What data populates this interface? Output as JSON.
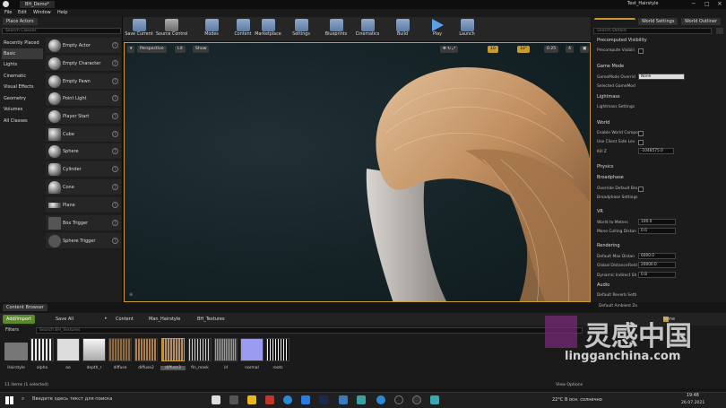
{
  "window": {
    "doc_title": "BH_Demo*",
    "project_title": "Test_Hairstyle"
  },
  "menu": [
    "File",
    "Edit",
    "Window",
    "Help"
  ],
  "place_actors": {
    "tab_label": "Place Actors",
    "search_placeholder": "Search Classes",
    "categories": [
      "Recently Placed",
      "Basic",
      "Lights",
      "Cinematic",
      "Visual Effects",
      "Geometry",
      "Volumes",
      "All Classes"
    ],
    "items": [
      "Empty Actor",
      "Empty Character",
      "Empty Pawn",
      "Point Light",
      "Player Start",
      "Cube",
      "Sphere",
      "Cylinder",
      "Cone",
      "Plane",
      "Box Trigger",
      "Sphere Trigger"
    ]
  },
  "toolbar": [
    "Save Current",
    "Source Control",
    "Modes",
    "Content",
    "Marketplace",
    "Settings",
    "Blueprints",
    "Cinematics",
    "Build",
    "Play",
    "Launch"
  ],
  "viewport": {
    "perspective": "Perspective",
    "lit": "Lit",
    "show": "Show",
    "snap_grid": "10",
    "snap_rot": "10°",
    "snap_scale": "0.25",
    "cam_speed": "4"
  },
  "details": {
    "tabs": [
      "World Settings",
      "World Outliner"
    ],
    "search_placeholder": "Search Details",
    "sections": [
      {
        "title": "Precomputed Visibility",
        "props": [
          {
            "label": "Precompute Visibili",
            "value": ""
          }
        ]
      },
      {
        "title": "Game Mode",
        "props": [
          {
            "label": "GameMode Overrid",
            "value": "None"
          },
          {
            "label": "Selected GameMod",
            "value": ""
          }
        ]
      },
      {
        "title": "Lightmass",
        "props": [
          {
            "label": "Lightmass Settings",
            "value": ""
          }
        ]
      },
      {
        "title": "World",
        "props": [
          {
            "label": "Enable World Compo",
            "value": ""
          },
          {
            "label": "Use Client Side Lev",
            "value": ""
          },
          {
            "label": "Kill Z",
            "value": "-1048575.0"
          }
        ]
      },
      {
        "title": "Physics",
        "props": []
      },
      {
        "title": "Broadphase",
        "props": [
          {
            "label": "Override Default Bro",
            "value": ""
          },
          {
            "label": "Broadphase Settings",
            "value": ""
          }
        ]
      },
      {
        "title": "VR",
        "props": [
          {
            "label": "World to Meters",
            "value": "100.0"
          },
          {
            "label": "Mono Culling Distan",
            "value": "0.0"
          }
        ]
      },
      {
        "title": "Rendering",
        "props": [
          {
            "label": "Default Max Distan",
            "value": "6000.0"
          },
          {
            "label": "Global DistanceField",
            "value": "20000.0"
          },
          {
            "label": "Dynamic Indirect Sh",
            "value": "0.8"
          }
        ]
      },
      {
        "title": "Audio",
        "props": [
          {
            "label": "Default Reverb Setti",
            "value": ""
          },
          {
            "label": "Default Ambient Zo",
            "value": ""
          }
        ]
      }
    ],
    "dropdown_value": "None"
  },
  "content_browser": {
    "tab_label": "Content Browser",
    "add_import": "Add/Import",
    "save_all": "Save All",
    "breadcrumb": [
      "Content",
      "Man_Hairstyle",
      "BH_Textures"
    ],
    "filters": "Filters",
    "search_placeholder": "Search BH_Textures",
    "assets": [
      "Hairstyle",
      "alpha",
      "ao",
      "depth_r",
      "diffuse",
      "diffuse2",
      "diffuse3",
      "fin_mask",
      "id",
      "normal",
      "roots"
    ],
    "status": "11 items (1 selected)",
    "view_options": "View Options"
  },
  "taskbar": {
    "search_placeholder": "Введите здесь текст для поиска",
    "weather": "22°C В осн. солнечно",
    "time": "19:48",
    "date": "26.07.2021"
  },
  "watermark": {
    "brand": "灵感中国",
    "url": "lingganchina.com"
  },
  "colors": {
    "accent": "#c89b2c",
    "play": "#5aa0e8",
    "add_import": "#5a8a2a",
    "selected_tab": "#c89b2c"
  }
}
